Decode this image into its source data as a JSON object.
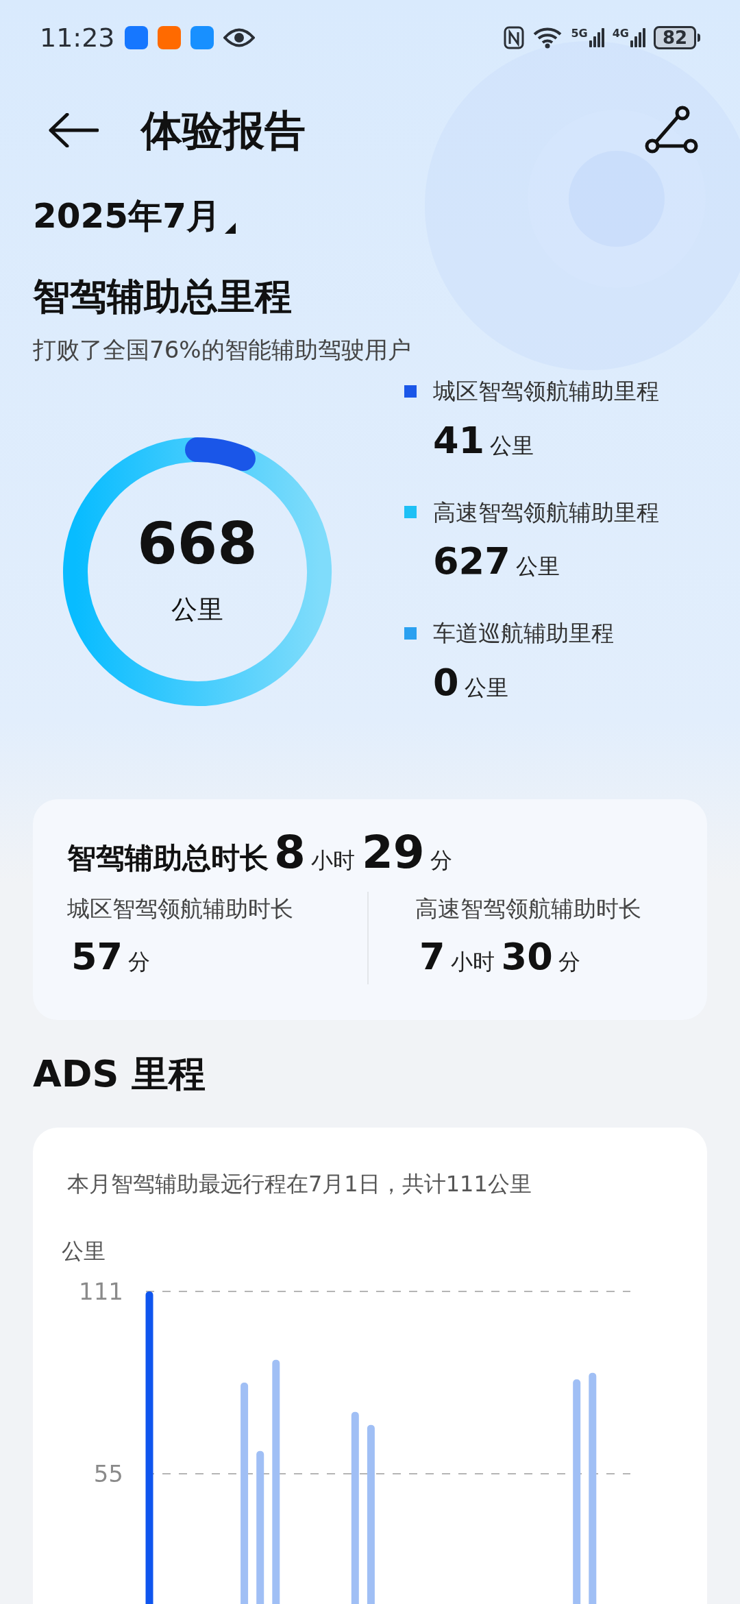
{
  "status_bar": {
    "time": "11:23",
    "network_1": "5G",
    "network_2": "4G",
    "battery": "82"
  },
  "header": {
    "title": "体验报告"
  },
  "month": "2025年7月",
  "mileage": {
    "title": "智驾辅助总里程",
    "subtitle": "打败了全国76%的智能辅助驾驶用户",
    "total": "668",
    "total_unit": "公里",
    "legend": [
      {
        "label": "城区智驾领航辅助里程",
        "value": "41",
        "unit": "公里",
        "color": "#1a56e8"
      },
      {
        "label": "高速智驾领航辅助里程",
        "value": "627",
        "unit": "公里",
        "color": "#1ec0f5"
      },
      {
        "label": "车道巡航辅助里程",
        "value": "0",
        "unit": "公里",
        "color": "#2aa0f0"
      }
    ]
  },
  "duration": {
    "title": "智驾辅助总时长",
    "parts": [
      {
        "num": "8",
        "unit": "小时"
      },
      {
        "num": "29",
        "unit": "分"
      }
    ],
    "columns": [
      {
        "label": "城区智驾领航辅助时长",
        "parts": [
          {
            "num": "57",
            "unit": "分"
          }
        ]
      },
      {
        "label": "高速智驾领航辅助时长",
        "parts": [
          {
            "num": "7",
            "unit": "小时"
          },
          {
            "num": "30",
            "unit": "分"
          }
        ]
      }
    ]
  },
  "ads": {
    "title": "ADS 里程",
    "note": "本月智驾辅助最远行程在7月1日，共计111公里",
    "chart_data": {
      "type": "bar",
      "ylabel": "公里",
      "ylim": [
        0,
        111
      ],
      "yticks": [
        55,
        111
      ],
      "stacked": true,
      "series": [
        {
          "color": "#0f55ee",
          "values": [
            111,
            null,
            null,
            null,
            null,
            null,
            null,
            null,
            null,
            null,
            null,
            null,
            null,
            null,
            null,
            null,
            null,
            null,
            null,
            null,
            null,
            null,
            null,
            null,
            null,
            null,
            null,
            null,
            null,
            null,
            null
          ]
        },
        {
          "color": "#a0bff5",
          "values": [
            null,
            null,
            null,
            null,
            null,
            null,
            83,
            62,
            90,
            null,
            null,
            null,
            null,
            74,
            70,
            null,
            null,
            null,
            null,
            null,
            null,
            null,
            null,
            null,
            null,
            null,
            null,
            84,
            86,
            null,
            null
          ]
        }
      ]
    }
  }
}
